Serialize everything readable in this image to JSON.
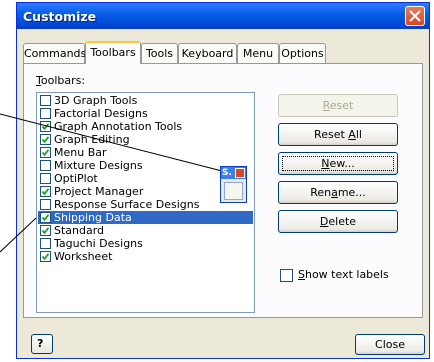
{
  "window": {
    "title": "Customize"
  },
  "tabs": [
    {
      "label": "Commands"
    },
    {
      "label": "Toolbars",
      "active": true
    },
    {
      "label": "Tools"
    },
    {
      "label": "Keyboard"
    },
    {
      "label": "Menu"
    },
    {
      "label": "Options"
    }
  ],
  "toolbars_label": {
    "prefix": "T",
    "rest": "oolbars:"
  },
  "toolbars": [
    {
      "label": "3D Graph Tools",
      "checked": false,
      "selected": false
    },
    {
      "label": "Factorial Designs",
      "checked": false,
      "selected": false
    },
    {
      "label": "Graph Annotation Tools",
      "checked": true,
      "selected": false
    },
    {
      "label": "Graph Editing",
      "checked": true,
      "selected": false
    },
    {
      "label": "Menu Bar",
      "checked": true,
      "selected": false
    },
    {
      "label": "Mixture Designs",
      "checked": false,
      "selected": false
    },
    {
      "label": "OptiPlot",
      "checked": false,
      "selected": false
    },
    {
      "label": "Project Manager",
      "checked": true,
      "selected": false
    },
    {
      "label": "Response Surface Designs",
      "checked": false,
      "selected": false
    },
    {
      "label": "Shipping Data",
      "checked": true,
      "selected": true
    },
    {
      "label": "Standard",
      "checked": true,
      "selected": false
    },
    {
      "label": "Taguchi Designs",
      "checked": false,
      "selected": false
    },
    {
      "label": "Worksheet",
      "checked": true,
      "selected": false
    }
  ],
  "buttons": {
    "reset": {
      "u": "R",
      "rest": "eset"
    },
    "reset_all": {
      "pre": "Reset ",
      "u": "A",
      "rest": "ll"
    },
    "new": {
      "u": "N",
      "rest": "ew..."
    },
    "rename": {
      "pre": "Ren",
      "u": "a",
      "rest": "me..."
    },
    "delete": {
      "u": "D",
      "rest": "elete"
    }
  },
  "show_text_labels": {
    "u": "S",
    "rest": "how text labels",
    "checked": false
  },
  "mini_toolbar": {
    "letter": "S."
  },
  "footer": {
    "help_glyph": "?",
    "close_label": "Close"
  }
}
